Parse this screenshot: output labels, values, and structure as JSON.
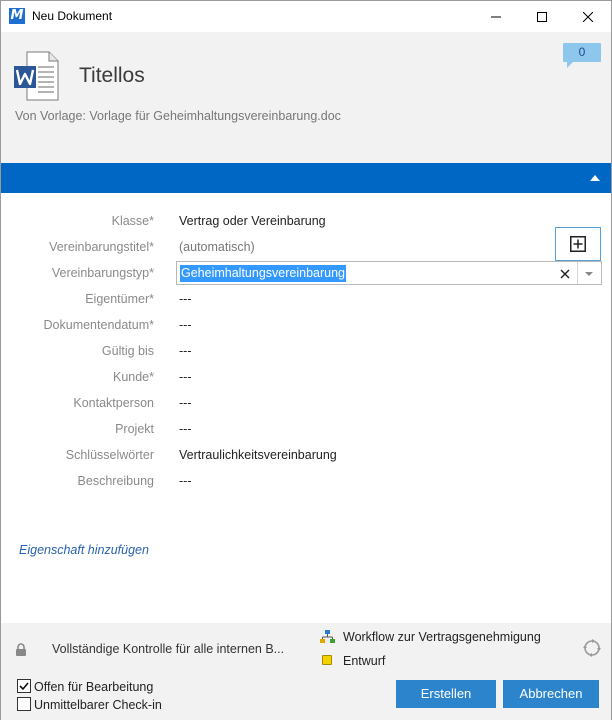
{
  "window": {
    "logo_letter": "M",
    "title": "Neu Dokument"
  },
  "header": {
    "doc_title": "Titellos",
    "template_line": "Von Vorlage: Vorlage für Geheimhaltungsvereinbarung.doc",
    "comment_count": "0",
    "doc_icon": "word-document-icon"
  },
  "form": {
    "rows": [
      {
        "label": "Klasse*",
        "value": "Vertrag oder Vereinbarung"
      },
      {
        "label": "Vereinbarungstitel*",
        "value": "(automatisch)"
      },
      {
        "label": "Vereinbarungstyp*",
        "value": "Geheimhaltungsvereinbarung"
      },
      {
        "label": "Eigentümer*",
        "value": "---"
      },
      {
        "label": "Dokumentendatum*",
        "value": "---"
      },
      {
        "label": "Gültig bis",
        "value": "---"
      },
      {
        "label": "Kunde*",
        "value": "---"
      },
      {
        "label": "Kontaktperson",
        "value": "---"
      },
      {
        "label": "Projekt",
        "value": "---"
      },
      {
        "label": "Schlüsselwörter",
        "value": "Vertraulichkeitsvereinbarung"
      },
      {
        "label": "Beschreibung",
        "value": "---"
      }
    ],
    "add_property": "Eigenschaft hinzufügen"
  },
  "status": {
    "permission": "Vollständige Kontrolle für alle internen B...",
    "workflow": "Workflow zur Vertragsgenehmigung",
    "state": "Entwurf",
    "state_color": "#f2d200"
  },
  "bottom": {
    "open_for_edit": "Offen für Bearbeitung",
    "open_for_edit_checked": true,
    "immediate_checkin": "Unmittelbarer Check-in",
    "immediate_checkin_checked": false,
    "create_label": "Erstellen",
    "cancel_label": "Abbrechen"
  },
  "colors": {
    "accent": "#0067c5",
    "button": "#2c84cd",
    "selection": "#3399ff"
  }
}
